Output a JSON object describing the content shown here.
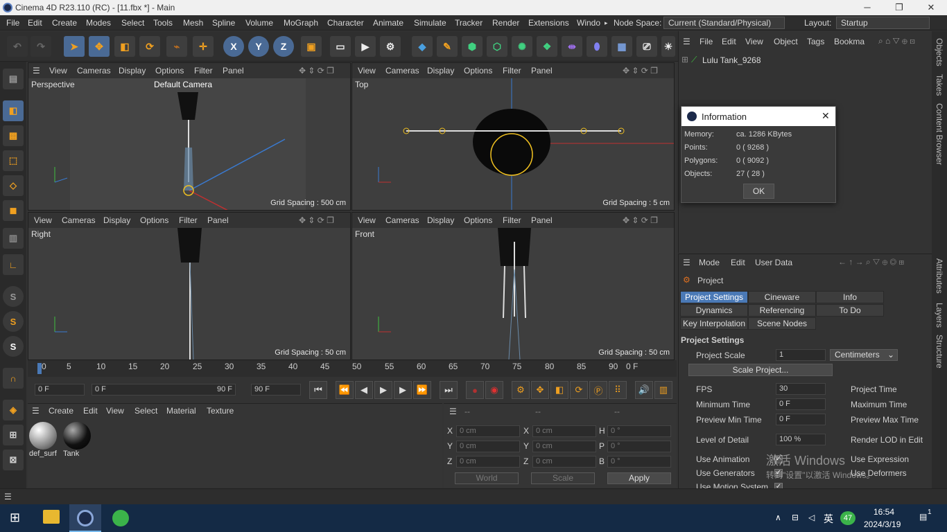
{
  "window": {
    "title": "Cinema 4D R23.110 (RC) - [11.fbx *] - Main",
    "min": "─",
    "max": "❐",
    "close": "✕"
  },
  "menu": [
    "File",
    "Edit",
    "Create",
    "Modes",
    "Select",
    "Tools",
    "Mesh",
    "Spline",
    "Volume",
    "MoGraph",
    "Character",
    "Animate",
    "Simulate",
    "Tracker",
    "Render",
    "Extensions",
    "Windo"
  ],
  "node_space": {
    "label": "Node Space:",
    "value": "Current (Standard/Physical)"
  },
  "layout": {
    "label": "Layout:",
    "value": "Startup"
  },
  "toolbar": {
    "x": "X",
    "y": "Y",
    "z": "Z"
  },
  "viewports": [
    {
      "menu": [
        "View",
        "Cameras",
        "Display",
        "Options",
        "Filter",
        "Panel"
      ],
      "name": "Perspective",
      "camera": "Default Camera",
      "grid": "Grid Spacing : 500 cm"
    },
    {
      "menu": [
        "View",
        "Cameras",
        "Display",
        "Options",
        "Filter",
        "Panel"
      ],
      "name": "Top",
      "grid": "Grid Spacing : 5 cm"
    },
    {
      "menu": [
        "View",
        "Cameras",
        "Display",
        "Options",
        "Filter",
        "Panel"
      ],
      "name": "Right",
      "grid": "Grid Spacing : 50 cm"
    },
    {
      "menu": [
        "View",
        "Cameras",
        "Display",
        "Options",
        "Filter",
        "Panel"
      ],
      "name": "Front",
      "grid": "Grid Spacing : 50 cm"
    }
  ],
  "objects": {
    "menu": [
      "File",
      "Edit",
      "View",
      "Object",
      "Tags",
      "Bookma"
    ],
    "item": "Lulu Tank_9268"
  },
  "info_dialog": {
    "title": "Information",
    "rows": [
      {
        "k": "Memory:",
        "v": "ca. 1286 KBytes"
      },
      {
        "k": "Points:",
        "v": "0 ( 9268 )"
      },
      {
        "k": "Polygons:",
        "v": "0 ( 9092 )"
      },
      {
        "k": "Objects:",
        "v": "27 ( 28 )"
      }
    ],
    "ok": "OK"
  },
  "side_tabs": [
    "Objects",
    "Takes",
    "Content Browser"
  ],
  "side_tabs2": [
    "Attributes",
    "Layers",
    "Structure"
  ],
  "timeline": {
    "ticks": [
      "0",
      "5",
      "10",
      "15",
      "20",
      "25",
      "30",
      "35",
      "40",
      "45",
      "50",
      "55",
      "60",
      "65",
      "70",
      "75",
      "80",
      "85",
      "90"
    ],
    "end": "0 F",
    "start_field": "0 F",
    "range_start": "0 F",
    "range_end": "90 F",
    "max_field": "90 F"
  },
  "materials": {
    "menu": [
      "Create",
      "Edit",
      "View",
      "Select",
      "Material",
      "Texture"
    ],
    "items": [
      "def_surf",
      "Tank"
    ]
  },
  "coords": {
    "headers": [
      "--",
      "--",
      "--"
    ],
    "rows": [
      {
        "a": "X",
        "av": "0 cm",
        "b": "X",
        "bv": "0 cm",
        "c": "H",
        "cv": "0 °"
      },
      {
        "a": "Y",
        "av": "0 cm",
        "b": "Y",
        "bv": "0 cm",
        "c": "P",
        "cv": "0 °"
      },
      {
        "a": "Z",
        "av": "0 cm",
        "b": "Z",
        "bv": "0 cm",
        "c": "B",
        "cv": "0 °"
      }
    ],
    "world": "World",
    "scale": "Scale",
    "apply": "Apply"
  },
  "attributes": {
    "menu": [
      "Mode",
      "Edit",
      "User Data"
    ],
    "object": "Project",
    "tabs": [
      "Project Settings",
      "Cineware",
      "Info",
      "Dynamics",
      "Referencing",
      "To Do",
      "Key Interpolation",
      "Scene Nodes"
    ],
    "section": "Project Settings",
    "project_scale_label": "Project Scale",
    "project_scale": "1",
    "units": "Centimeters",
    "scale_btn": "Scale Project...",
    "fields": [
      {
        "k": "FPS",
        "v": "30",
        "r": "Project Time"
      },
      {
        "k": "Minimum Time",
        "v": "0 F",
        "r": "Maximum Time"
      },
      {
        "k": "Preview Min Time",
        "v": "0 F",
        "r": "Preview Max Time"
      },
      {
        "k": "Level of Detail",
        "v": "100 %",
        "r": "Render LOD in Edit"
      }
    ],
    "checks": [
      {
        "k": "Use Animation",
        "r": "Use Expression"
      },
      {
        "k": "Use Generators",
        "r": "Use Deformers"
      },
      {
        "k": "Use Motion System",
        "r": ""
      }
    ]
  },
  "watermark": {
    "line1": "激活 Windows",
    "line2": "转到\"设置\"以激活 Windows。"
  },
  "taskbar": {
    "ime": "英",
    "badge": "47",
    "time": "16:54",
    "date": "2024/3/19",
    "notif": "1"
  }
}
